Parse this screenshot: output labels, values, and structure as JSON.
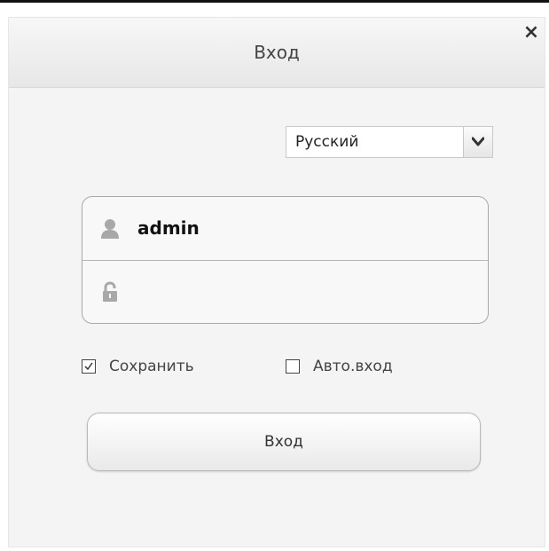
{
  "dialog": {
    "title": "Вход",
    "close_label": "×"
  },
  "language": {
    "selected": "Русский"
  },
  "credentials": {
    "username": "admin",
    "password": ""
  },
  "options": {
    "save": {
      "label": "Сохранить",
      "checked": true
    },
    "auto_login": {
      "label": "Авто.вход",
      "checked": false
    }
  },
  "actions": {
    "login_label": "Вход"
  },
  "colors": {
    "header_bg": "#ededed",
    "panel_bg": "#f4f4f4",
    "border": "#a9a9a9"
  }
}
